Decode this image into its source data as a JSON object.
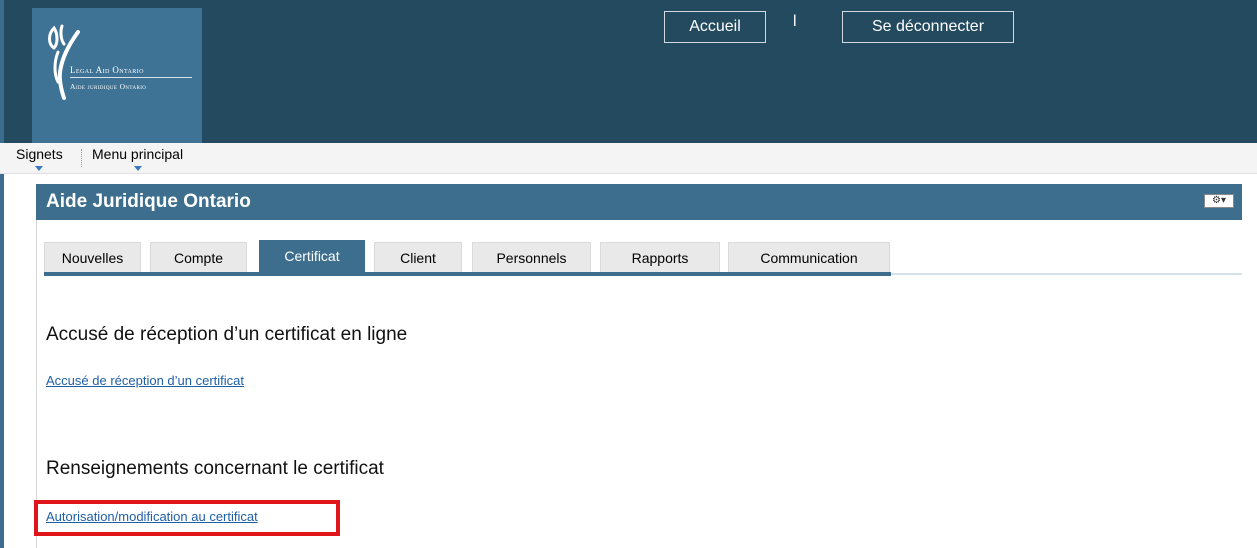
{
  "header": {
    "logo_line1": "Legal Aid Ontario",
    "logo_line2": "Aide juridique Ontario",
    "home_button": "Accueil",
    "user_separator": "l",
    "logout_button": "Se déconnecter"
  },
  "menubar": {
    "signets": "Signets",
    "main_menu": "Menu principal"
  },
  "portlet": {
    "title": "Aide Juridique Ontario",
    "options_icon": "gear-icon"
  },
  "tabs": [
    {
      "label": "Nouvelles",
      "active": false
    },
    {
      "label": "Compte",
      "active": false
    },
    {
      "label": "Certificat",
      "active": true
    },
    {
      "label": "Client",
      "active": false
    },
    {
      "label": "Personnels",
      "active": false
    },
    {
      "label": "Rapports",
      "active": false
    },
    {
      "label": "Communication",
      "active": false
    }
  ],
  "content": {
    "section1_title": "Accusé de réception d’un certificat en ligne",
    "section1_link": "Accusé de réception d’un certificat",
    "section2_title": "Renseignements concernant le certificat",
    "section2_link": "Autorisation/modification au certificat"
  },
  "colors": {
    "banner": "#234a5f",
    "accent": "#3d6e8d",
    "link": "#1f5fa8",
    "highlight": "#e0151b"
  }
}
